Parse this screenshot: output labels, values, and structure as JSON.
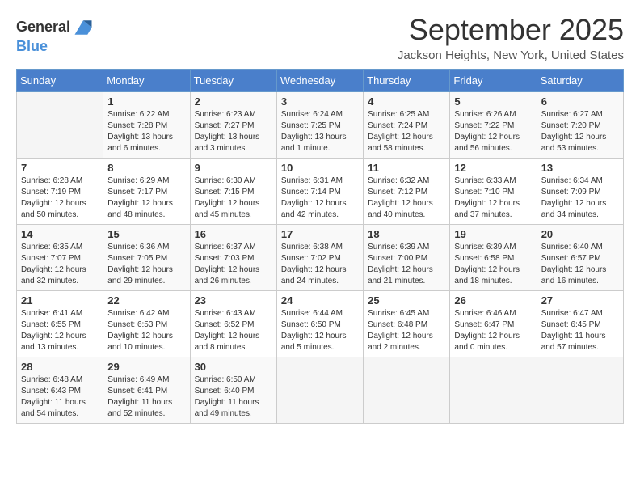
{
  "header": {
    "logo_line1": "General",
    "logo_line2": "Blue",
    "month": "September 2025",
    "location": "Jackson Heights, New York, United States"
  },
  "days_of_week": [
    "Sunday",
    "Monday",
    "Tuesday",
    "Wednesday",
    "Thursday",
    "Friday",
    "Saturday"
  ],
  "weeks": [
    [
      {
        "num": "",
        "sunrise": "",
        "sunset": "",
        "daylight": ""
      },
      {
        "num": "1",
        "sunrise": "Sunrise: 6:22 AM",
        "sunset": "Sunset: 7:28 PM",
        "daylight": "Daylight: 13 hours and 6 minutes."
      },
      {
        "num": "2",
        "sunrise": "Sunrise: 6:23 AM",
        "sunset": "Sunset: 7:27 PM",
        "daylight": "Daylight: 13 hours and 3 minutes."
      },
      {
        "num": "3",
        "sunrise": "Sunrise: 6:24 AM",
        "sunset": "Sunset: 7:25 PM",
        "daylight": "Daylight: 13 hours and 1 minute."
      },
      {
        "num": "4",
        "sunrise": "Sunrise: 6:25 AM",
        "sunset": "Sunset: 7:24 PM",
        "daylight": "Daylight: 12 hours and 58 minutes."
      },
      {
        "num": "5",
        "sunrise": "Sunrise: 6:26 AM",
        "sunset": "Sunset: 7:22 PM",
        "daylight": "Daylight: 12 hours and 56 minutes."
      },
      {
        "num": "6",
        "sunrise": "Sunrise: 6:27 AM",
        "sunset": "Sunset: 7:20 PM",
        "daylight": "Daylight: 12 hours and 53 minutes."
      }
    ],
    [
      {
        "num": "7",
        "sunrise": "Sunrise: 6:28 AM",
        "sunset": "Sunset: 7:19 PM",
        "daylight": "Daylight: 12 hours and 50 minutes."
      },
      {
        "num": "8",
        "sunrise": "Sunrise: 6:29 AM",
        "sunset": "Sunset: 7:17 PM",
        "daylight": "Daylight: 12 hours and 48 minutes."
      },
      {
        "num": "9",
        "sunrise": "Sunrise: 6:30 AM",
        "sunset": "Sunset: 7:15 PM",
        "daylight": "Daylight: 12 hours and 45 minutes."
      },
      {
        "num": "10",
        "sunrise": "Sunrise: 6:31 AM",
        "sunset": "Sunset: 7:14 PM",
        "daylight": "Daylight: 12 hours and 42 minutes."
      },
      {
        "num": "11",
        "sunrise": "Sunrise: 6:32 AM",
        "sunset": "Sunset: 7:12 PM",
        "daylight": "Daylight: 12 hours and 40 minutes."
      },
      {
        "num": "12",
        "sunrise": "Sunrise: 6:33 AM",
        "sunset": "Sunset: 7:10 PM",
        "daylight": "Daylight: 12 hours and 37 minutes."
      },
      {
        "num": "13",
        "sunrise": "Sunrise: 6:34 AM",
        "sunset": "Sunset: 7:09 PM",
        "daylight": "Daylight: 12 hours and 34 minutes."
      }
    ],
    [
      {
        "num": "14",
        "sunrise": "Sunrise: 6:35 AM",
        "sunset": "Sunset: 7:07 PM",
        "daylight": "Daylight: 12 hours and 32 minutes."
      },
      {
        "num": "15",
        "sunrise": "Sunrise: 6:36 AM",
        "sunset": "Sunset: 7:05 PM",
        "daylight": "Daylight: 12 hours and 29 minutes."
      },
      {
        "num": "16",
        "sunrise": "Sunrise: 6:37 AM",
        "sunset": "Sunset: 7:03 PM",
        "daylight": "Daylight: 12 hours and 26 minutes."
      },
      {
        "num": "17",
        "sunrise": "Sunrise: 6:38 AM",
        "sunset": "Sunset: 7:02 PM",
        "daylight": "Daylight: 12 hours and 24 minutes."
      },
      {
        "num": "18",
        "sunrise": "Sunrise: 6:39 AM",
        "sunset": "Sunset: 7:00 PM",
        "daylight": "Daylight: 12 hours and 21 minutes."
      },
      {
        "num": "19",
        "sunrise": "Sunrise: 6:39 AM",
        "sunset": "Sunset: 6:58 PM",
        "daylight": "Daylight: 12 hours and 18 minutes."
      },
      {
        "num": "20",
        "sunrise": "Sunrise: 6:40 AM",
        "sunset": "Sunset: 6:57 PM",
        "daylight": "Daylight: 12 hours and 16 minutes."
      }
    ],
    [
      {
        "num": "21",
        "sunrise": "Sunrise: 6:41 AM",
        "sunset": "Sunset: 6:55 PM",
        "daylight": "Daylight: 12 hours and 13 minutes."
      },
      {
        "num": "22",
        "sunrise": "Sunrise: 6:42 AM",
        "sunset": "Sunset: 6:53 PM",
        "daylight": "Daylight: 12 hours and 10 minutes."
      },
      {
        "num": "23",
        "sunrise": "Sunrise: 6:43 AM",
        "sunset": "Sunset: 6:52 PM",
        "daylight": "Daylight: 12 hours and 8 minutes."
      },
      {
        "num": "24",
        "sunrise": "Sunrise: 6:44 AM",
        "sunset": "Sunset: 6:50 PM",
        "daylight": "Daylight: 12 hours and 5 minutes."
      },
      {
        "num": "25",
        "sunrise": "Sunrise: 6:45 AM",
        "sunset": "Sunset: 6:48 PM",
        "daylight": "Daylight: 12 hours and 2 minutes."
      },
      {
        "num": "26",
        "sunrise": "Sunrise: 6:46 AM",
        "sunset": "Sunset: 6:47 PM",
        "daylight": "Daylight: 12 hours and 0 minutes."
      },
      {
        "num": "27",
        "sunrise": "Sunrise: 6:47 AM",
        "sunset": "Sunset: 6:45 PM",
        "daylight": "Daylight: 11 hours and 57 minutes."
      }
    ],
    [
      {
        "num": "28",
        "sunrise": "Sunrise: 6:48 AM",
        "sunset": "Sunset: 6:43 PM",
        "daylight": "Daylight: 11 hours and 54 minutes."
      },
      {
        "num": "29",
        "sunrise": "Sunrise: 6:49 AM",
        "sunset": "Sunset: 6:41 PM",
        "daylight": "Daylight: 11 hours and 52 minutes."
      },
      {
        "num": "30",
        "sunrise": "Sunrise: 6:50 AM",
        "sunset": "Sunset: 6:40 PM",
        "daylight": "Daylight: 11 hours and 49 minutes."
      },
      {
        "num": "",
        "sunrise": "",
        "sunset": "",
        "daylight": ""
      },
      {
        "num": "",
        "sunrise": "",
        "sunset": "",
        "daylight": ""
      },
      {
        "num": "",
        "sunrise": "",
        "sunset": "",
        "daylight": ""
      },
      {
        "num": "",
        "sunrise": "",
        "sunset": "",
        "daylight": ""
      }
    ]
  ]
}
